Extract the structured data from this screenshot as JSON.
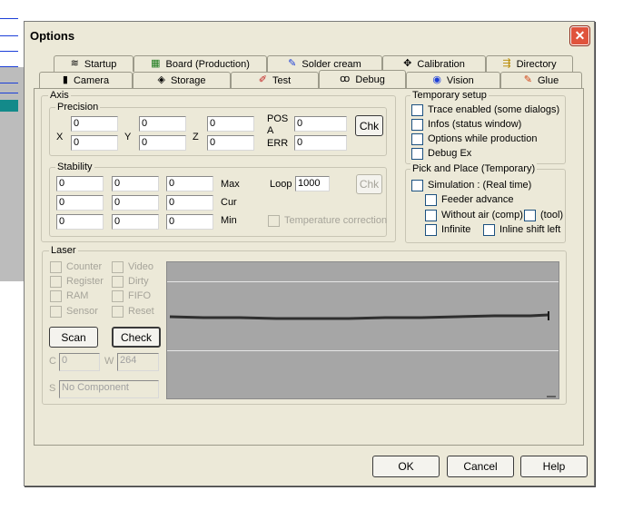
{
  "dialog": {
    "title": "Options",
    "close_glyph": "✕"
  },
  "tabs_row1": [
    {
      "label": "Startup",
      "icon": "≋"
    },
    {
      "label": "Board (Production)",
      "icon": "▦"
    },
    {
      "label": "Solder cream",
      "icon": "✎"
    },
    {
      "label": "Calibration",
      "icon": "✥"
    },
    {
      "label": "Directory",
      "icon": "⇶"
    }
  ],
  "tabs_row2": [
    {
      "label": "Camera",
      "icon": "▮"
    },
    {
      "label": "Storage",
      "icon": "◈"
    },
    {
      "label": "Test",
      "icon": "✐"
    },
    {
      "label": "Debug",
      "icon": "ꝏ"
    },
    {
      "label": "Vision",
      "icon": "◉"
    },
    {
      "label": "Glue",
      "icon": "✎"
    }
  ],
  "axis": {
    "title": "Axis",
    "precision": {
      "title": "Precision",
      "x_label": "X",
      "y_label": "Y",
      "z_label": "Z",
      "x_values": [
        "0",
        "0"
      ],
      "y_values": [
        "0",
        "0"
      ],
      "z_values": [
        "0",
        "0"
      ],
      "pos_label": "POS",
      "a_label": "A",
      "err_label": "ERR",
      "pos_value": "0",
      "err_value": "0",
      "chk_label": "Chk"
    },
    "stability": {
      "title": "Stability",
      "rows": [
        {
          "values": [
            "0",
            "0",
            "0"
          ],
          "label": "Max"
        },
        {
          "values": [
            "0",
            "0",
            "0"
          ],
          "label": "Cur"
        },
        {
          "values": [
            "0",
            "0",
            "0"
          ],
          "label": "Min"
        }
      ],
      "loop_label": "Loop",
      "loop_value": "1000",
      "chk_label": "Chk",
      "temperature_label": "Temperature correction"
    }
  },
  "temporary_setup": {
    "title": "Temporary setup",
    "items": [
      "Trace enabled (some dialogs)",
      "Infos (status window)",
      "Options while production",
      "Debug Ex"
    ]
  },
  "pick_place": {
    "title": "Pick and Place (Temporary)",
    "simulation": "Simulation : (Real time)",
    "feeder": "Feeder advance",
    "without_air": "Without air (comp)",
    "tool": "(tool)",
    "infinite": "Infinite",
    "inline_shift": "Inline shift left"
  },
  "laser": {
    "title": "Laser",
    "checks_left": [
      "Counter",
      "Register",
      "RAM",
      "Sensor"
    ],
    "checks_right": [
      "Video",
      "Dirty",
      "FIFO",
      "Reset"
    ],
    "scan_label": "Scan",
    "check_label": "Check",
    "c_label": "C",
    "c_value": "0",
    "w_label": "W",
    "w_value": "264",
    "s_label": "S",
    "s_value": "No Component"
  },
  "buttons": {
    "ok": "OK",
    "cancel": "Cancel",
    "help": "Help"
  },
  "colors": {
    "graph_bg": "#a6a6a6",
    "close_red": "#e0533c",
    "dialog_bg": "#ece9d8"
  }
}
